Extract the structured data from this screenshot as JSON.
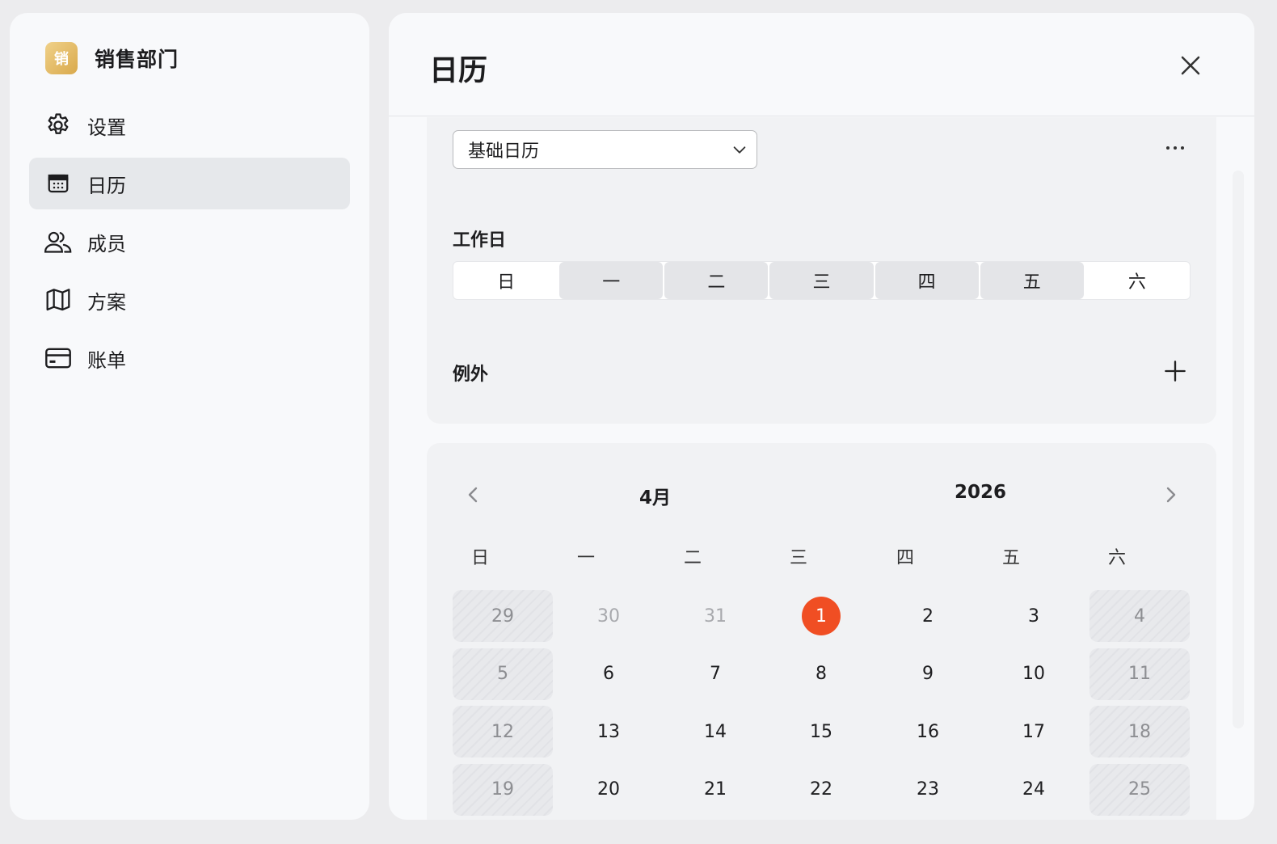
{
  "org": {
    "logo_char": "销",
    "name": "销售部门"
  },
  "nav": [
    {
      "label": "设置",
      "icon": "gear-icon"
    },
    {
      "label": "日历",
      "icon": "calendar-icon",
      "active": true
    },
    {
      "label": "成员",
      "icon": "users-icon"
    },
    {
      "label": "方案",
      "icon": "map-icon"
    },
    {
      "label": "账单",
      "icon": "credit-card-icon"
    }
  ],
  "panel": {
    "title": "日历",
    "calendar_select": {
      "value": "基础日历"
    },
    "workdays_label": "工作日",
    "workdays": [
      {
        "label": "日",
        "on": false
      },
      {
        "label": "一",
        "on": true
      },
      {
        "label": "二",
        "on": true
      },
      {
        "label": "三",
        "on": true
      },
      {
        "label": "四",
        "on": true
      },
      {
        "label": "五",
        "on": true
      },
      {
        "label": "六",
        "on": false
      }
    ],
    "exceptions_label": "例外"
  },
  "calendar": {
    "month": "4月",
    "year": "2026",
    "weekdays": [
      "日",
      "一",
      "二",
      "三",
      "四",
      "五",
      "六"
    ],
    "weeks": [
      [
        "29",
        "30",
        "31",
        "1",
        "2",
        "3",
        "4"
      ],
      [
        "5",
        "6",
        "7",
        "8",
        "9",
        "10",
        "11"
      ],
      [
        "12",
        "13",
        "14",
        "15",
        "16",
        "17",
        "18"
      ],
      [
        "19",
        "20",
        "21",
        "22",
        "23",
        "24",
        "25"
      ]
    ],
    "outside_month": [
      "29",
      "30",
      "31"
    ],
    "today": "1",
    "today_color": "#f04e23"
  },
  "colors": {
    "accent": "#f04e23",
    "active_nav": "#e6e8eb"
  }
}
